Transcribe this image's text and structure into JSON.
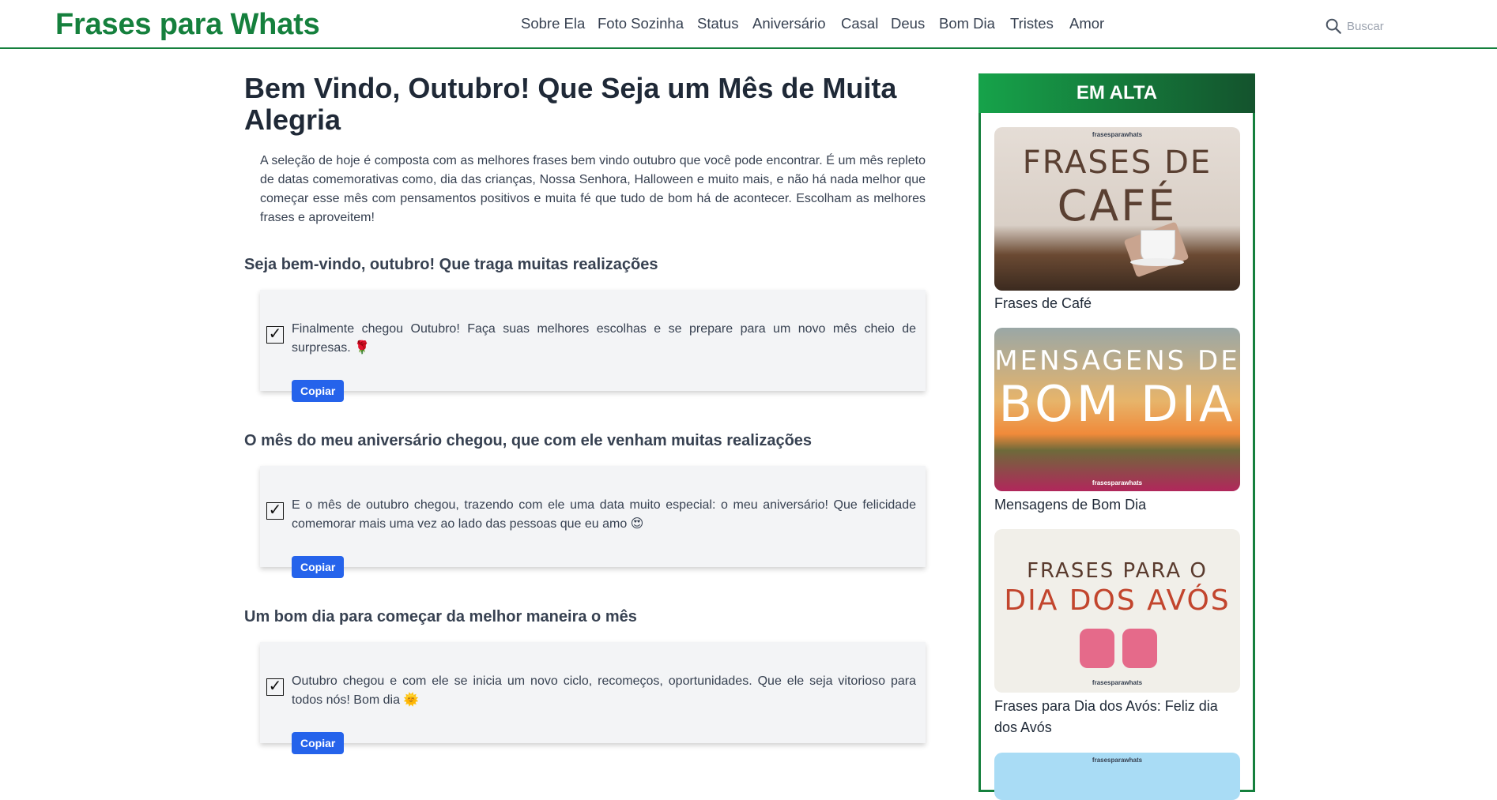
{
  "header": {
    "logo": "Frases para Whats",
    "nav": [
      "Sobre Ela",
      "Foto Sozinha",
      "Status",
      "Aniversário",
      "Casal",
      "Deus",
      "Bom Dia",
      "Tristes",
      "Amor"
    ],
    "search_placeholder": "Buscar",
    "accent": "#15803d"
  },
  "article": {
    "title": "Bem Vindo, Outubro! Que Seja um Mês de Muita Alegria",
    "intro": "A seleção de hoje é composta com as melhores frases bem vindo outubro que você pode encontrar. É um mês repleto de datas comemorativas como, dia das crianças, Nossa Senhora, Halloween e muito mais, e não há nada melhor que começar esse mês com pensamentos positivos e muita fé que tudo de bom há de acontecer. Escolham as melhores frases e aproveitem!",
    "sections": [
      {
        "heading": "Seja bem-vindo, outubro! Que traga muitas realizações",
        "quote": "Finalmente chegou Outubro! Faça suas melhores escolhas e se prepare para um novo mês cheio de surpresas. 🌹",
        "button": "Copiar"
      },
      {
        "heading": "O mês do meu aniversário chegou, que com ele venham muitas realizações",
        "quote": "E o mês de outubro chegou, trazendo com ele uma data muito especial: o meu aniversário! Que felicidade comemorar mais uma vez ao lado das pessoas que eu amo 😍",
        "button": "Copiar"
      },
      {
        "heading": "Um bom dia para começar da melhor maneira o mês",
        "quote": "Outubro chegou e com ele se inicia um novo ciclo, recomeços, oportunidades. Que ele seja vitorioso para todos nós! Bom dia 🌞",
        "button": "Copiar"
      }
    ],
    "check_glyph": "✓",
    "button_color": "#2563eb"
  },
  "sidebar": {
    "heading": "EM ALTA",
    "items": [
      {
        "image_text_1": "FRASES DE",
        "image_text_2": "CAFÉ",
        "brand": "frasesparawhats",
        "caption": "Frases de Café"
      },
      {
        "image_text_1": "MENSAGENS DE",
        "image_text_2": "BOM DIA",
        "brand": "frasesparawhats",
        "caption": "Mensagens de Bom Dia"
      },
      {
        "image_text_1": "FRASES PARA O",
        "image_text_2": "DIA DOS AVÓS",
        "brand": "frasesparawhats",
        "caption": "Frases para Dia dos Avós: Feliz dia dos Avós"
      },
      {
        "brand": "frasesparawhats"
      }
    ]
  }
}
